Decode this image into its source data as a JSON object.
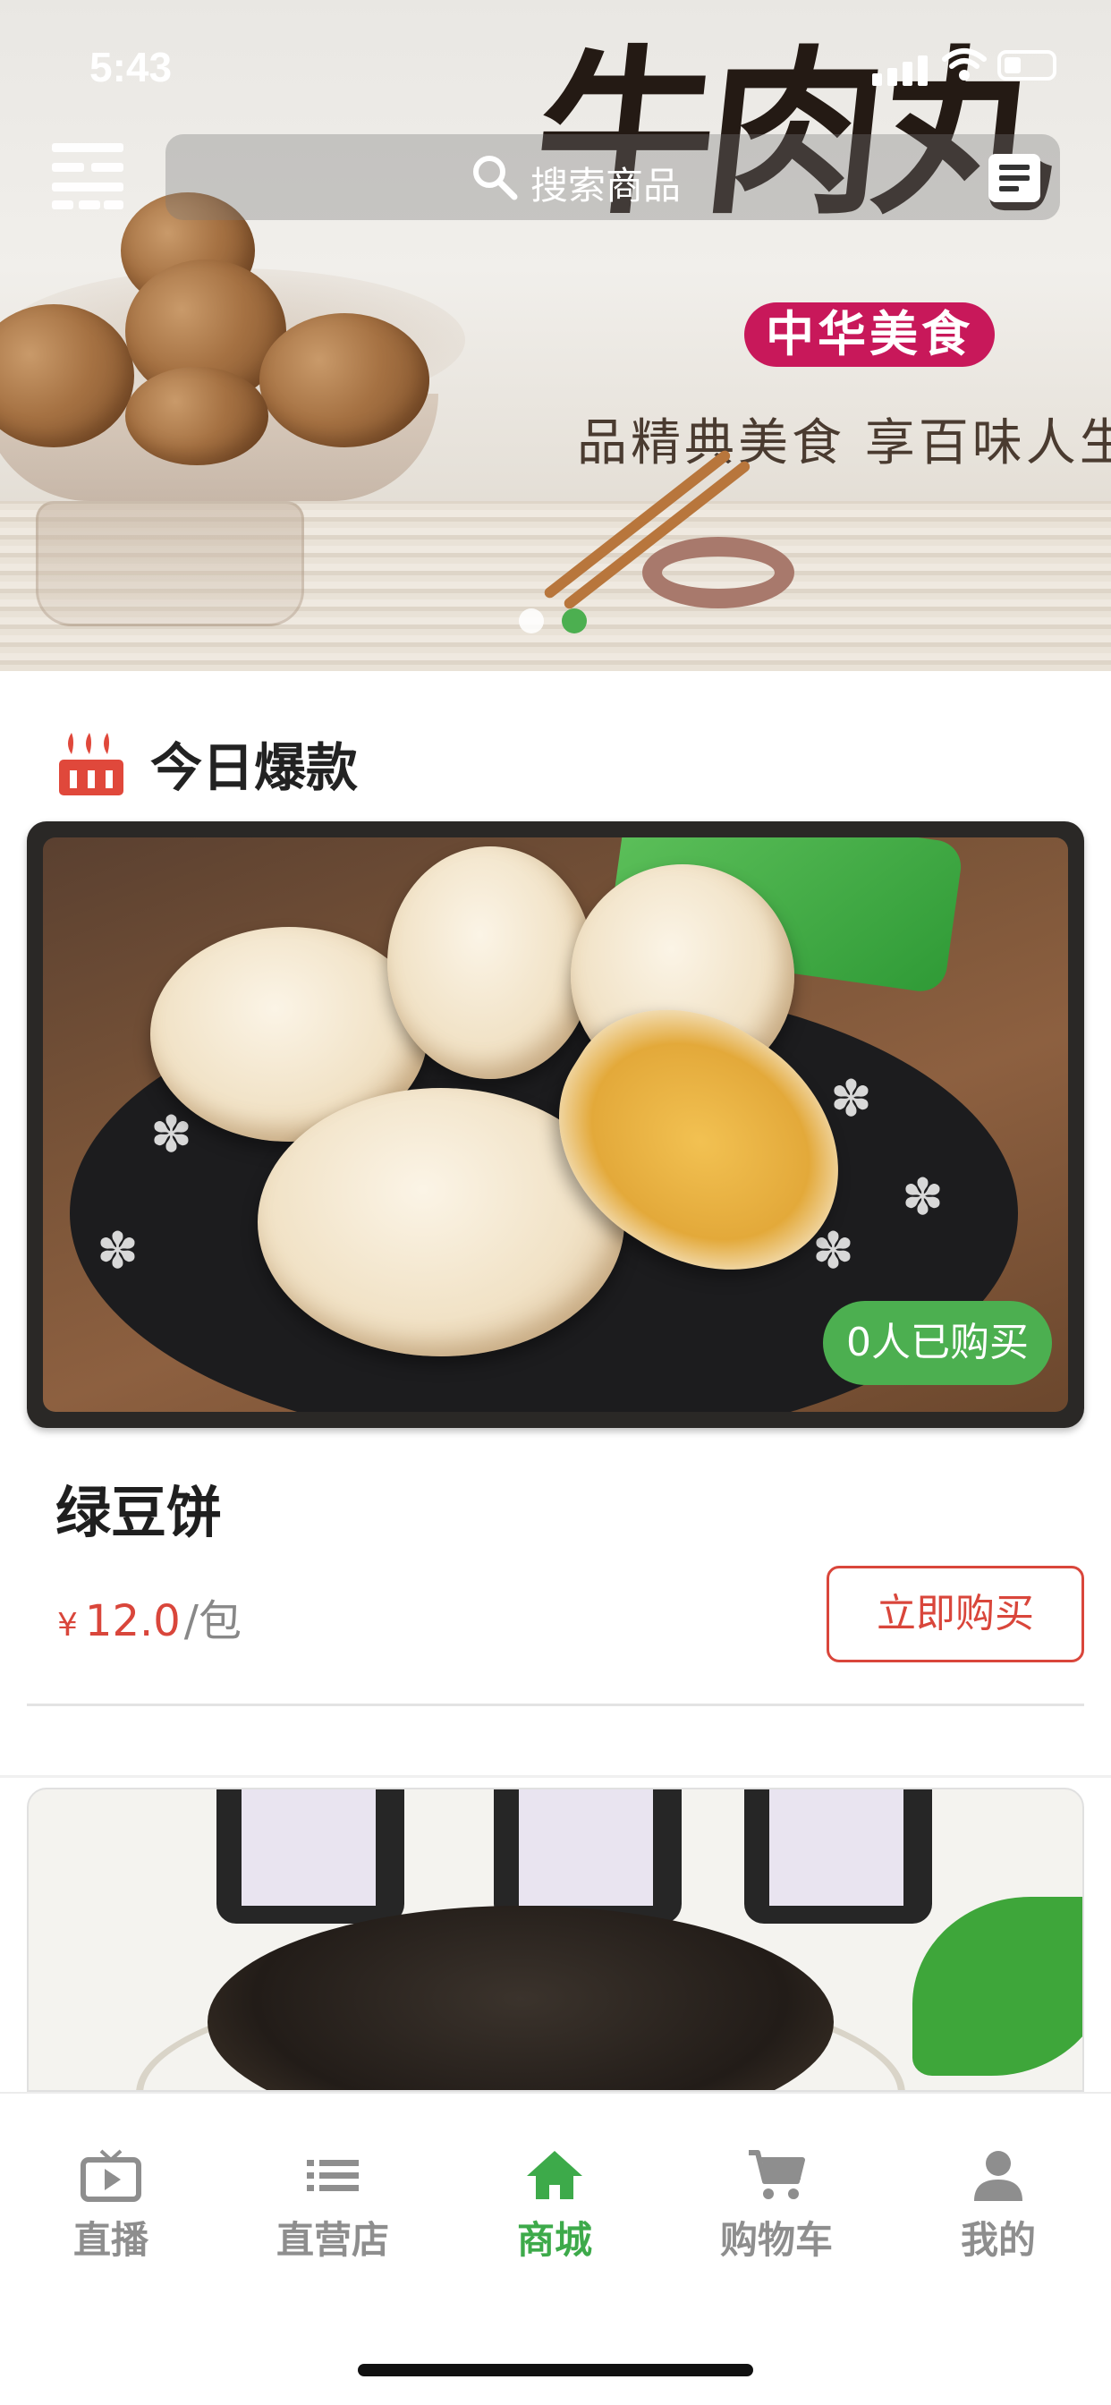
{
  "status_bar": {
    "time": "5:43"
  },
  "banner": {
    "title": "牛肉丸",
    "seal_text": "中华美食",
    "slogan": "品精典美食 享百味人生",
    "carousel_total": 2,
    "carousel_active": 2
  },
  "search": {
    "placeholder": "搜索商品"
  },
  "section": {
    "title": "今日爆款"
  },
  "product": {
    "name": "绿豆饼",
    "sold_badge": "0人已购买",
    "currency": "¥",
    "price": "12.0",
    "unit": "/包",
    "buy_label": "立即购买"
  },
  "tabbar": {
    "items": [
      {
        "label": "直播",
        "icon": "tv-icon",
        "active": false
      },
      {
        "label": "直营店",
        "icon": "list-icon",
        "active": false
      },
      {
        "label": "商城",
        "icon": "home-icon",
        "active": true
      },
      {
        "label": "购物车",
        "icon": "cart-icon",
        "active": false
      },
      {
        "label": "我的",
        "icon": "user-icon",
        "active": false
      }
    ]
  },
  "colors": {
    "accent_green": "#4caf50",
    "tab_active": "#3daa4a",
    "price_red": "#d9463b",
    "seal_magenta": "#c8185a"
  }
}
